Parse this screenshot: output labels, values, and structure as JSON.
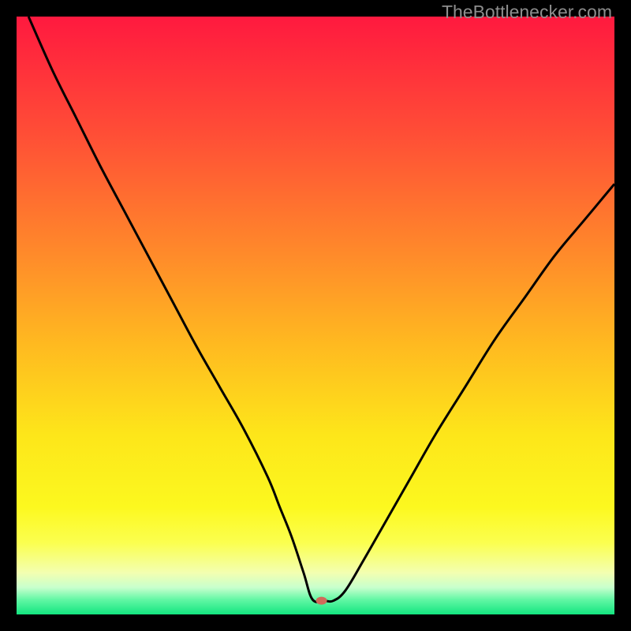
{
  "watermark": "TheBottlenecker.com",
  "chart_data": {
    "type": "line",
    "title": "",
    "xlabel": "",
    "ylabel": "",
    "xlim": [
      0,
      100
    ],
    "ylim": [
      0,
      100
    ],
    "background": {
      "type": "vertical-gradient",
      "stops": [
        {
          "offset": 0.0,
          "color": "#ff193f"
        },
        {
          "offset": 0.2,
          "color": "#ff4f36"
        },
        {
          "offset": 0.4,
          "color": "#ff8b2a"
        },
        {
          "offset": 0.55,
          "color": "#ffba20"
        },
        {
          "offset": 0.7,
          "color": "#fde61a"
        },
        {
          "offset": 0.82,
          "color": "#fcf81f"
        },
        {
          "offset": 0.88,
          "color": "#fbff4f"
        },
        {
          "offset": 0.93,
          "color": "#f3ffb0"
        },
        {
          "offset": 0.955,
          "color": "#c8ffcd"
        },
        {
          "offset": 0.975,
          "color": "#63f7a5"
        },
        {
          "offset": 1.0,
          "color": "#13e57f"
        }
      ]
    },
    "series": [
      {
        "name": "bottleneck-curve",
        "color": "#000000",
        "stroke_width": 3,
        "x": [
          2,
          6,
          10,
          14,
          18,
          22,
          26,
          30,
          34,
          38,
          42,
          44,
          46,
          48,
          49.5,
          51.5,
          53,
          55,
          58,
          62,
          66,
          70,
          75,
          80,
          85,
          90,
          95,
          100
        ],
        "y": [
          100,
          91,
          83,
          75,
          67.5,
          60,
          52.5,
          45,
          38,
          31,
          23,
          18,
          13,
          7,
          2.5,
          2.3,
          2.3,
          4,
          9,
          16,
          23,
          30,
          38,
          46,
          53,
          60,
          66,
          72
        ]
      }
    ],
    "marker": {
      "name": "optimal-point",
      "x": 51,
      "y": 2.3,
      "color": "#d06a5a",
      "rx": 7,
      "ry": 5
    }
  }
}
